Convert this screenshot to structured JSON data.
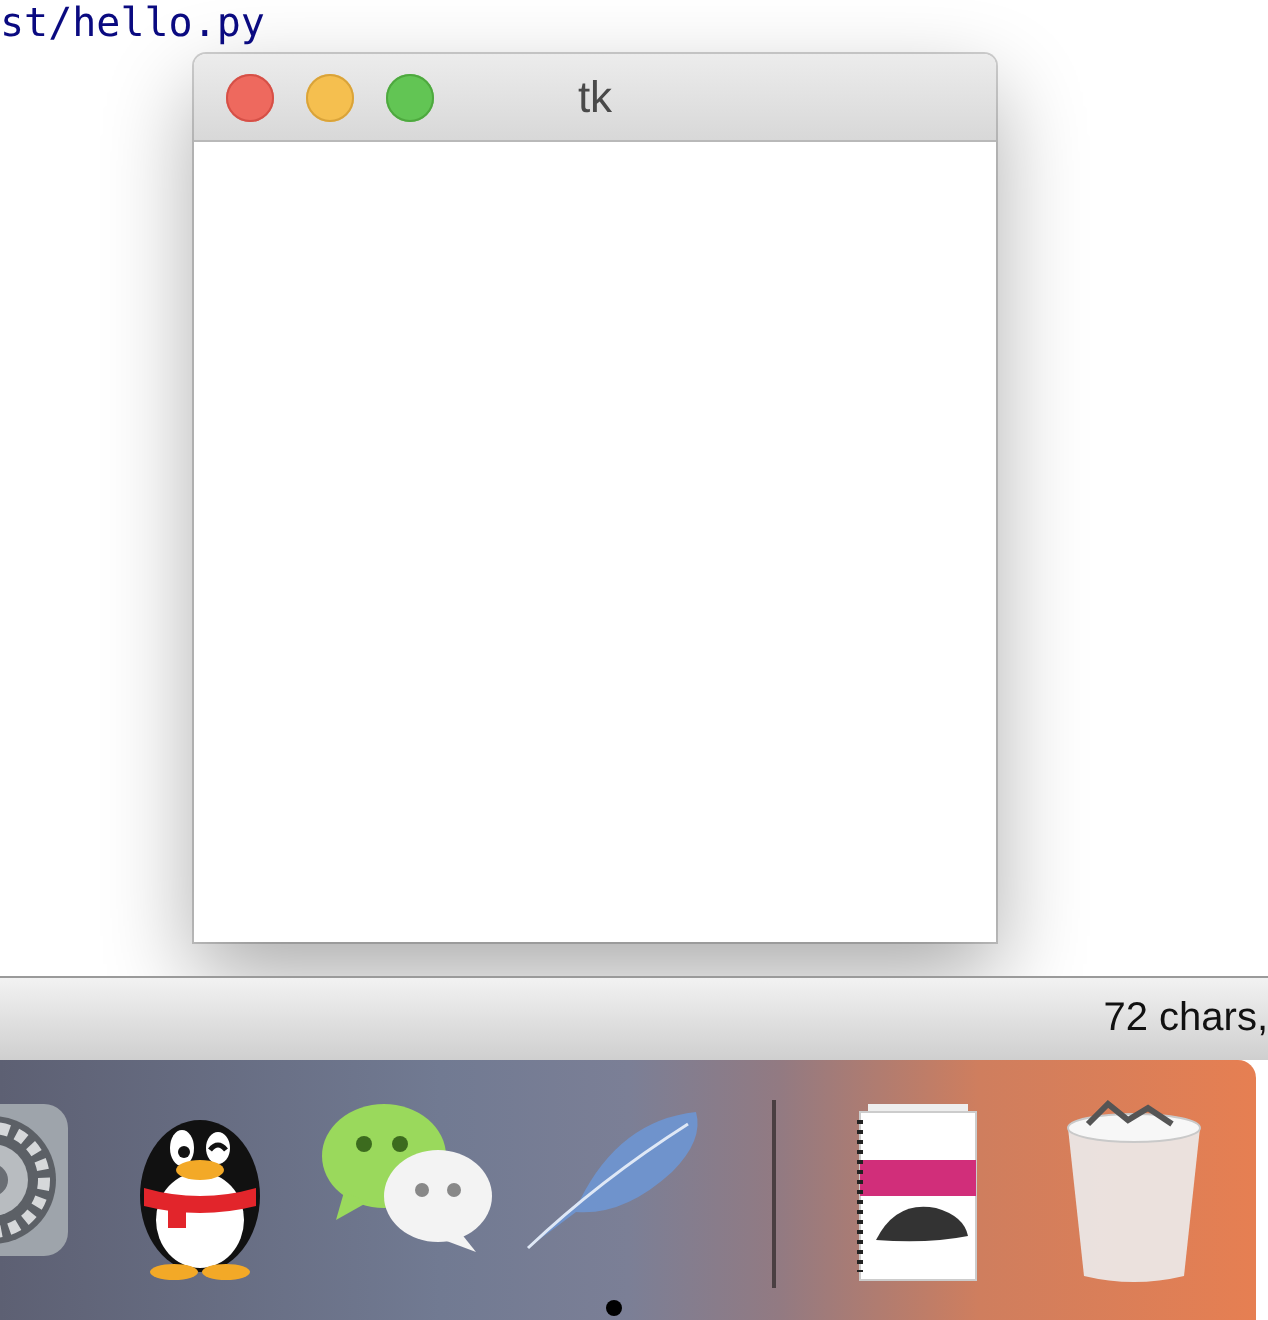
{
  "editor": {
    "text": "st/hello.py"
  },
  "window": {
    "title": "tk"
  },
  "status_bar": {
    "text": "72 chars,"
  },
  "dock": {
    "items": [
      {
        "kind": "gear",
        "running": false
      },
      {
        "kind": "penguin",
        "running": false
      },
      {
        "kind": "chat",
        "running": false
      },
      {
        "kind": "feather",
        "running": true
      },
      {
        "kind": "separator"
      },
      {
        "kind": "book",
        "running": false
      },
      {
        "kind": "trash",
        "running": false
      }
    ]
  }
}
